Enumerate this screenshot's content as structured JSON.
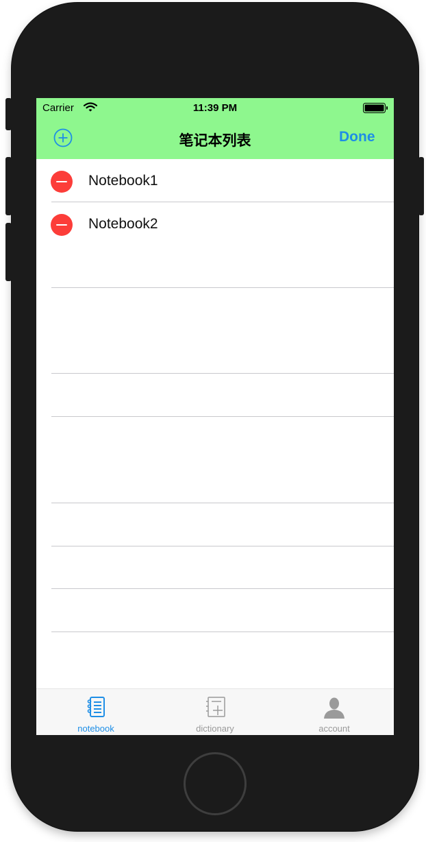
{
  "status_bar": {
    "carrier": "Carrier",
    "time": "11:39 PM"
  },
  "nav_bar": {
    "title": "笔记本列表",
    "done_label": "Done",
    "add_icon": "plus-circle-icon"
  },
  "notebooks": [
    {
      "label": "Notebook1"
    },
    {
      "label": "Notebook2"
    }
  ],
  "tab_bar": {
    "tabs": [
      {
        "label": "notebook",
        "icon": "notebook-icon",
        "active": true
      },
      {
        "label": "dictionary",
        "icon": "dictionary-icon",
        "active": false
      },
      {
        "label": "account",
        "icon": "account-icon",
        "active": false
      }
    ]
  },
  "colors": {
    "bar_green": "#8ef78e",
    "accent_blue": "#1e8ee6",
    "delete_red": "#fc3d39",
    "tab_gray": "#9a9a9a"
  }
}
